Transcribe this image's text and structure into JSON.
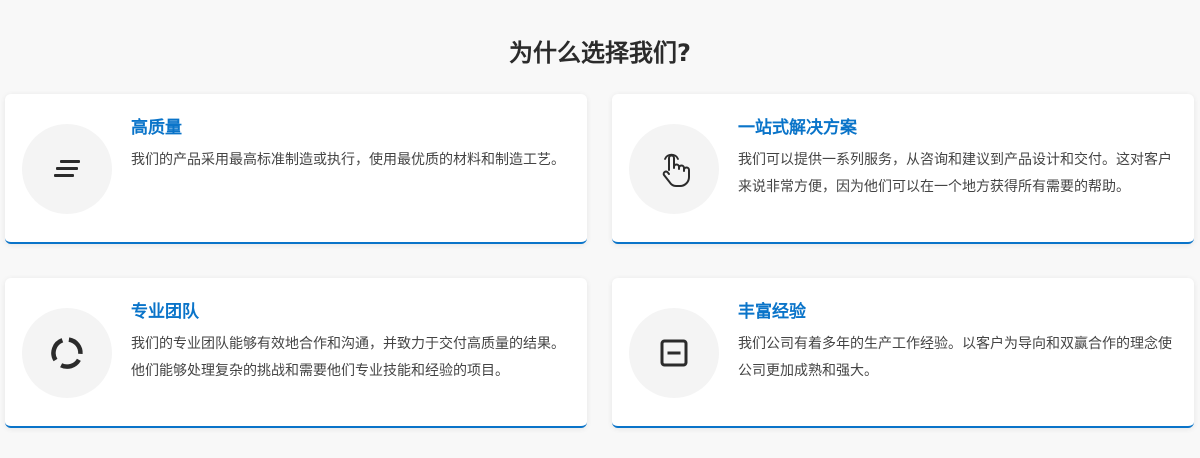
{
  "section": {
    "title": "为什么选择我们?"
  },
  "features": [
    {
      "icon": "align-lines-icon",
      "title": "高质量",
      "description": "我们的产品采用最高标准制造或执行，使用最优质的材料和制造工艺。"
    },
    {
      "icon": "hand-pointer-icon",
      "title": "一站式解决方案",
      "description": "我们可以提供一系列服务，从咨询和建议到产品设计和交付。这对客户来说非常方便，因为他们可以在一个地方获得所有需要的帮助。"
    },
    {
      "icon": "circle-segments-icon",
      "title": "专业团队",
      "description": "我们的专业团队能够有效地合作和沟通，并致力于交付高质量的结果。他们能够处理复杂的挑战和需要他们专业技能和经验的项目。"
    },
    {
      "icon": "minus-square-icon",
      "title": "丰富经验",
      "description": "我们公司有着多年的生产工作经验。以客户为导向和双赢合作的理念使公司更加成熟和强大。"
    }
  ],
  "colors": {
    "accent": "#0a74c9",
    "background": "#f8f8f8",
    "card": "#ffffff",
    "icon_circle": "#f4f4f4"
  }
}
